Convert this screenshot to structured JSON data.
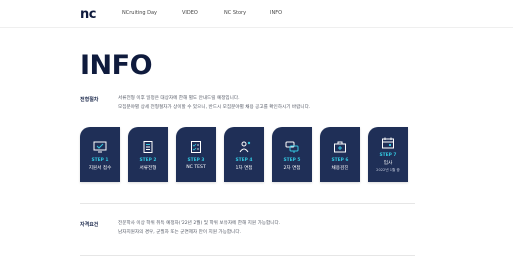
{
  "nav": {
    "logo": "nc",
    "items": [
      "NCruiting Day",
      "VIDEO",
      "NC Story",
      "INFO"
    ]
  },
  "page_title": "INFO",
  "process": {
    "label": "전형절차",
    "lines": [
      "서류전형 이후 일정은 대상자에 한해 별도 안내드릴 예정입니다.",
      "모집분야별 상세 전형절차가 상이할 수 있으니, 반드시 모집분야별 채용 공고를 확인하시기 바랍니다."
    ]
  },
  "steps": [
    {
      "num": "STEP 1",
      "label": "지원서 접수",
      "icon": "monitor-check-icon"
    },
    {
      "num": "STEP 2",
      "label": "서류전형",
      "icon": "document-list-icon"
    },
    {
      "num": "STEP 3",
      "label": "NC TEST",
      "icon": "checklist-icon"
    },
    {
      "num": "STEP 4",
      "label": "1차 면접",
      "icon": "interview-people-icon"
    },
    {
      "num": "STEP 5",
      "label": "2차 면접",
      "icon": "chat-bubbles-icon"
    },
    {
      "num": "STEP 6",
      "label": "채용검진",
      "icon": "medical-kit-icon"
    },
    {
      "num": "STEP 7",
      "label": "입사",
      "sub": "2022년 1월 중",
      "icon": "calendar-icon"
    }
  ],
  "qualification": {
    "label": "자격요건",
    "lines": [
      "전문학사 이상 학위 취득 예정자('22년 2월) 및 학위 보유자에 한해 지원 가능합니다.",
      "남자지원자의 경우, 군필자 또는 군면제자 만이 지원 가능합니다."
    ]
  },
  "colors": {
    "navy": "#1f2f57",
    "accent": "#33c7e0",
    "title": "#0f1b3d"
  }
}
